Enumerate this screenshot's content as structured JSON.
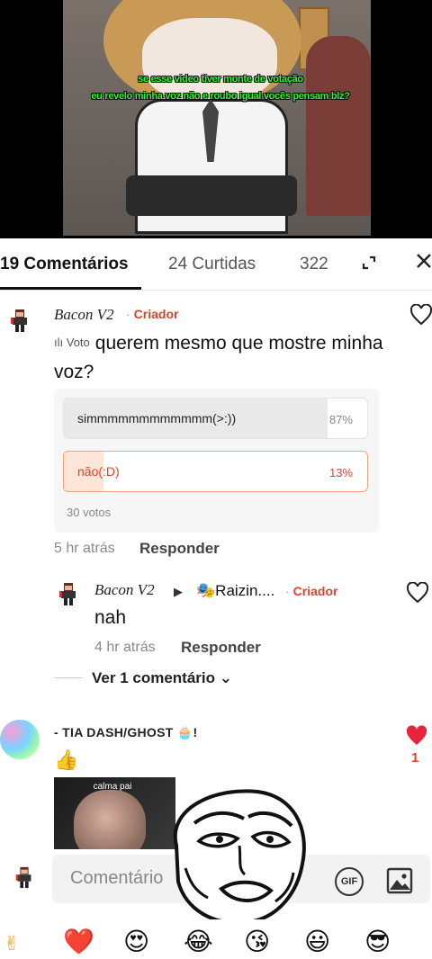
{
  "video": {
    "caption_line1": "se esse video tiver monte de votação",
    "caption_line2": "eu revelo minha voz não e roubo igual vocês pensam blz?"
  },
  "tabs": {
    "comments": "19 Comentários",
    "likes": "24 Curtidas",
    "views": "322"
  },
  "comment1": {
    "author": "Bacon V2",
    "role": "Criador",
    "vote_tag": "Voto",
    "text": "querem mesmo que mostre minha voz?",
    "poll": {
      "options": [
        {
          "label": "simmmmmmmmmmmm(>:))",
          "percent": "87%",
          "fill": 0.87
        },
        {
          "label": "não(:D)",
          "percent": "13%",
          "fill": 0.13
        }
      ],
      "votes": "30 votos"
    },
    "time": "5 hr atrás",
    "reply": "Responder"
  },
  "reply1": {
    "author": "Bacon V2",
    "mention": "Raizin....",
    "role": "Criador",
    "text": "nah",
    "time": "4 hr atrás",
    "reply": "Responder",
    "view_more": "Ver 1 comentário"
  },
  "comment2": {
    "author": "- TIA DASH/GHOST 🧁!",
    "text": "👍",
    "sticker_caption": "calma pai",
    "likes": "1"
  },
  "input": {
    "placeholder": "Comentário",
    "gif": "GIF"
  },
  "emojis": [
    "❤️",
    "😍",
    "😂",
    "😘",
    "😃",
    "😎"
  ],
  "colors": {
    "accent": "#e0412c",
    "heart": "#e8243a"
  }
}
